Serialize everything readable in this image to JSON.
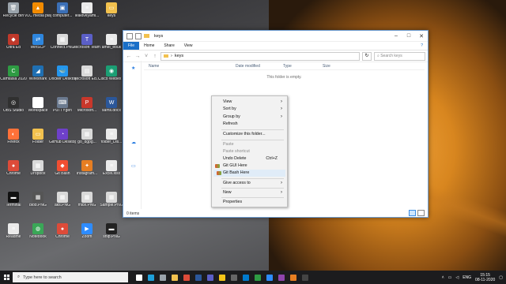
{
  "desktop": {
    "icons": [
      {
        "label": "Recycle Bin",
        "color": "#9aa3ab",
        "glyph": "🗑",
        "col": 0,
        "row": 0
      },
      {
        "label": "VLC media player",
        "color": "#f28b00",
        "glyph": "▲",
        "col": 1,
        "row": 0
      },
      {
        "label": "computer...",
        "color": "#3b6fb6",
        "glyph": "▣",
        "col": 2,
        "row": 0
      },
      {
        "label": "leaktveyaml...",
        "color": "#eaeaea",
        "glyph": "≡",
        "col": 3,
        "row": 0
      },
      {
        "label": "keys",
        "color": "#f2c14e",
        "glyph": "▭",
        "col": 4,
        "row": 0
      },
      {
        "label": "Ultra Ed",
        "color": "#c0392b",
        "glyph": "◆",
        "col": 0,
        "row": 1
      },
      {
        "label": "WinSCP",
        "color": "#2e86de",
        "glyph": "⇄",
        "col": 1,
        "row": 1
      },
      {
        "label": "Connect.PNG",
        "color": "#d9d9d9",
        "glyph": "▦",
        "col": 2,
        "row": 1
      },
      {
        "label": "Microsoft Teams",
        "color": "#5b5fc7",
        "glyph": "T",
        "col": 3,
        "row": 1
      },
      {
        "label": "amel_ebuk",
        "color": "#eaeaea",
        "glyph": "≡",
        "col": 4,
        "row": 1
      },
      {
        "label": "Camtasia 2020",
        "color": "#2e9b43",
        "glyph": "C",
        "col": 0,
        "row": 2
      },
      {
        "label": "Wireshark",
        "color": "#1f6fb2",
        "glyph": "◢",
        "col": 1,
        "row": 2
      },
      {
        "label": "Docker Desktop",
        "color": "#2496ed",
        "glyph": "🐳",
        "col": 2,
        "row": 2
      },
      {
        "label": "Microsoft Ed...",
        "color": "#d9d9d9",
        "glyph": "▤",
        "col": 3,
        "row": 2
      },
      {
        "label": "Cisco Webex Meetings",
        "color": "#1b9f74",
        "glyph": "◉",
        "col": 4,
        "row": 2
      },
      {
        "label": "OBS Studio",
        "color": "#303030",
        "glyph": "◎",
        "col": 0,
        "row": 3
      },
      {
        "label": "Workspace",
        "color": "#ffffff",
        "glyph": "▥",
        "col": 1,
        "row": 3
      },
      {
        "label": "PuTTYgen",
        "color": "#6b7a8f",
        "glyph": "⌨",
        "col": 2,
        "row": 3
      },
      {
        "label": "Microsoft...",
        "color": "#c8372b",
        "glyph": "P",
        "col": 3,
        "row": 3
      },
      {
        "label": "sams.docx",
        "color": "#2b579a",
        "glyph": "W",
        "col": 4,
        "row": 3
      },
      {
        "label": "Firefox",
        "color": "#ff7139",
        "glyph": "◐",
        "col": 0,
        "row": 4
      },
      {
        "label": "Folder",
        "color": "#f2c14e",
        "glyph": "▭",
        "col": 1,
        "row": 4
      },
      {
        "label": "GitHub Desktop",
        "color": "#6e40c9",
        "glyph": "◔",
        "col": 2,
        "row": 4
      },
      {
        "label": "go_dgpg...",
        "color": "#d9d9d9",
        "glyph": "▦",
        "col": 3,
        "row": 4
      },
      {
        "label": "folder_Dis...",
        "color": "#eaeaea",
        "glyph": "≡",
        "col": 4,
        "row": 4
      },
      {
        "label": "Chrome",
        "color": "#dd4b39",
        "glyph": "●",
        "col": 0,
        "row": 5
      },
      {
        "label": "Dropbox",
        "color": "#d9d9d9",
        "glyph": "▦",
        "col": 1,
        "row": 5
      },
      {
        "label": "Git Bash",
        "color": "#f14e32",
        "glyph": "◆",
        "col": 2,
        "row": 5
      },
      {
        "label": "Instagram...",
        "color": "#e67e22",
        "glyph": "✦",
        "col": 3,
        "row": 5
      },
      {
        "label": "Excel.xlsx",
        "color": "#eaeaea",
        "glyph": "≡",
        "col": 4,
        "row": 5
      },
      {
        "label": "Terminal",
        "color": "#111111",
        "glyph": "▬",
        "col": 0,
        "row": 6
      },
      {
        "label": "blob.PNG",
        "color": "#555555",
        "glyph": "▦",
        "col": 1,
        "row": 6
      },
      {
        "label": "aks.PNG",
        "color": "#d9d9d9",
        "glyph": "▦",
        "col": 2,
        "row": 6
      },
      {
        "label": "mice.PNG",
        "color": "#d9d9d9",
        "glyph": "▦",
        "col": 3,
        "row": 6
      },
      {
        "label": "Sample.PNG",
        "color": "#d9d9d9",
        "glyph": "▦",
        "col": 4,
        "row": 6
      },
      {
        "label": "Readme",
        "color": "#eaeaea",
        "glyph": "≡",
        "col": 0,
        "row": 7
      },
      {
        "label": "Notebook",
        "color": "#3aa757",
        "glyph": "◍",
        "col": 1,
        "row": 7
      },
      {
        "label": "Chrome",
        "color": "#dd4b39",
        "glyph": "●",
        "col": 2,
        "row": 7
      },
      {
        "label": "Zoom",
        "color": "#2d8cff",
        "glyph": "▶",
        "col": 3,
        "row": 7
      },
      {
        "label": "snip.PNG",
        "color": "#222222",
        "glyph": "▬",
        "col": 4,
        "row": 7
      }
    ]
  },
  "explorer": {
    "title": "keys",
    "ribbon_tabs": [
      "File",
      "Home",
      "Share",
      "View"
    ],
    "path": "keys",
    "search_placeholder": "Search keys",
    "columns": {
      "name": "Name",
      "date": "Date modified",
      "type": "Type",
      "size": "Size"
    },
    "empty_message": "This folder is empty.",
    "status": "0 items",
    "controls": {
      "minimize": "–",
      "maximize": "□",
      "close": "✕"
    }
  },
  "context_menu": {
    "view": "View",
    "sort_by": "Sort by",
    "group_by": "Group by",
    "refresh": "Refresh",
    "customize": "Customize this folder...",
    "paste": "Paste",
    "paste_shortcut": "Paste shortcut",
    "undo_delete": "Undo Delete",
    "undo_shortcut": "Ctrl+Z",
    "git_gui": "Git GUI Here",
    "git_bash": "Git Bash Here",
    "give_access": "Give access to",
    "new": "New",
    "properties": "Properties"
  },
  "taskbar": {
    "search_placeholder": "Type here to search",
    "apps": [
      {
        "name": "task-view",
        "color": "#ffffff"
      },
      {
        "name": "edge",
        "color": "#1e9fd9"
      },
      {
        "name": "mail",
        "color": "#9aa3ab"
      },
      {
        "name": "explorer",
        "color": "#f2c14e"
      },
      {
        "name": "chrome",
        "color": "#dd4b39"
      },
      {
        "name": "word",
        "color": "#2b579a"
      },
      {
        "name": "teams",
        "color": "#5b5fc7"
      },
      {
        "name": "sticky",
        "color": "#f5c518"
      },
      {
        "name": "obs",
        "color": "#666666"
      },
      {
        "name": "vscode",
        "color": "#007acc"
      },
      {
        "name": "camtasia",
        "color": "#2e9b43"
      },
      {
        "name": "zoom",
        "color": "#2d8cff"
      },
      {
        "name": "snip",
        "color": "#8e44ad"
      },
      {
        "name": "paint",
        "color": "#e67e22"
      },
      {
        "name": "cmd",
        "color": "#444444"
      }
    ],
    "lang": "ENG",
    "time": "15:15",
    "date": "08-11-2020"
  }
}
